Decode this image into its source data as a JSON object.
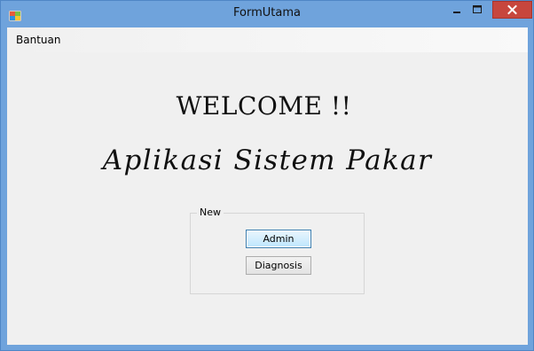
{
  "window": {
    "title": "FormUtama",
    "icon": "windows-form-icon",
    "controls": [
      "minimize",
      "maximize",
      "close"
    ]
  },
  "menubar": {
    "items": [
      {
        "label": "Bantuan"
      }
    ]
  },
  "main": {
    "welcome": "WELCOME !!",
    "app_name": "Aplikasi Sistem Pakar"
  },
  "groupbox": {
    "legend": "New",
    "buttons": {
      "admin": "Admin",
      "diagnosis": "Diagnosis"
    }
  },
  "colors": {
    "titlebar": "#6fa3dc",
    "client": "#f0f0f0",
    "close_button": "#c7463d"
  }
}
